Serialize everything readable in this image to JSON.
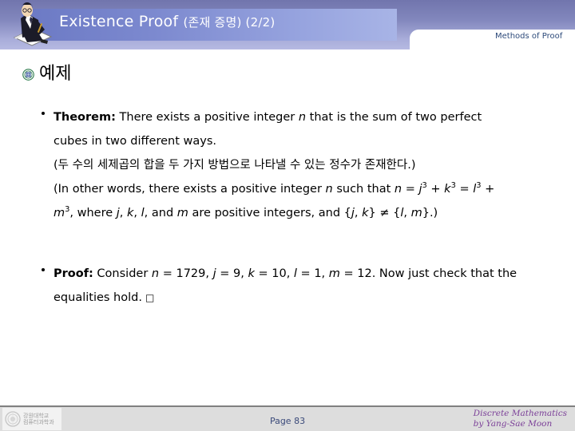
{
  "header": {
    "title_main": "Existence Proof",
    "title_sub": "(존재 증명) (2/2)",
    "chapter_label": "Methods of Proof",
    "title_icon": "person-writing-icon",
    "colors": {
      "band_top": "#7175ad",
      "band_bottom": "#b6b9e2",
      "title_bar_left": "#6b79c4",
      "title_bar_right": "#a8b4e6",
      "chapter_text": "#2d4a7a"
    }
  },
  "body": {
    "section_title": "예제",
    "section_icon": "seal-bullet-icon",
    "blocks": [
      {
        "bullet": "•",
        "lines": [
          "Theorem: There exists a positive integer n that is the sum of two perfect",
          "cubes in two different ways.",
          "(두 수의 세제곱의 합을 두 가지 방법으로 나타낼 수 있는 정수가 존재한다.)",
          "(In other words, there exists a positive integer n such that n = j3 + k3 = l3 +",
          "m3, where j, k, l, and m are positive integers, and {j, k} ≠ {l, m}.)"
        ],
        "label": "Theorem:",
        "korean": "(두 수의 세제곱의 합을 두 가지 방법으로 나타낼 수 있는 정수가 존재한다.)"
      },
      {
        "bullet": "•",
        "label": "Proof:",
        "lines": [
          "Proof: Consider n = 1729, j = 9, k = 10, l = 1, m = 12. Now just check that the",
          "equalities hold. □"
        ],
        "values": {
          "n": "1729",
          "j": "9",
          "k": "10",
          "l": "1",
          "m": "12"
        },
        "qed": "□"
      }
    ]
  },
  "footer": {
    "page_label": "Page 83",
    "credit_line1": "Discrete Mathematics",
    "credit_line2": "by Yang-Sae Moon",
    "logo_line1": "강원대학교",
    "logo_line2": "컴퓨터과학과",
    "logo_icon": "university-crest-icon",
    "credit_color": "#7b3f98",
    "page_color": "#3b4a7a"
  }
}
